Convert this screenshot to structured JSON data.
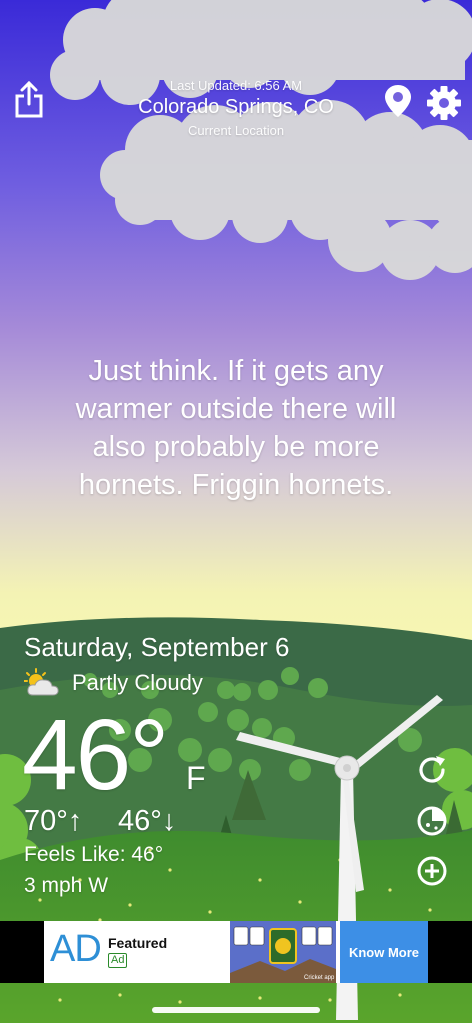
{
  "header": {
    "last_updated": "Last Updated: 6:56 AM",
    "location": "Colorado Springs, CO",
    "location_sub": "Current Location"
  },
  "quote": "Just think. If it gets any warmer outside there will also probably be more hornets. Friggin hornets.",
  "weather": {
    "date": "Saturday, September 6",
    "condition": "Partly Cloudy",
    "condition_icon": "partly-cloudy-icon",
    "temperature": "46°",
    "unit": "F",
    "high": "70°↑",
    "low": "46°↓",
    "feels_like": "Feels Like: 46°",
    "wind": "3 mph W"
  },
  "actions": {
    "refresh_icon": "refresh-icon",
    "radar_icon": "radar-icon",
    "add_icon": "add-location-icon"
  },
  "ad": {
    "logo": "AD",
    "featured": "Featured",
    "tag": "Ad",
    "image_caption": "Cricket app",
    "cta": "Know More"
  },
  "colors": {
    "sky_top": "#3f2fd9",
    "sky_mid": "#a98bd9",
    "sky_low": "#f7f8b0",
    "hills": "#3f6e4a",
    "grass": "#4f9a2b",
    "ad_button": "#3d8fe6"
  }
}
